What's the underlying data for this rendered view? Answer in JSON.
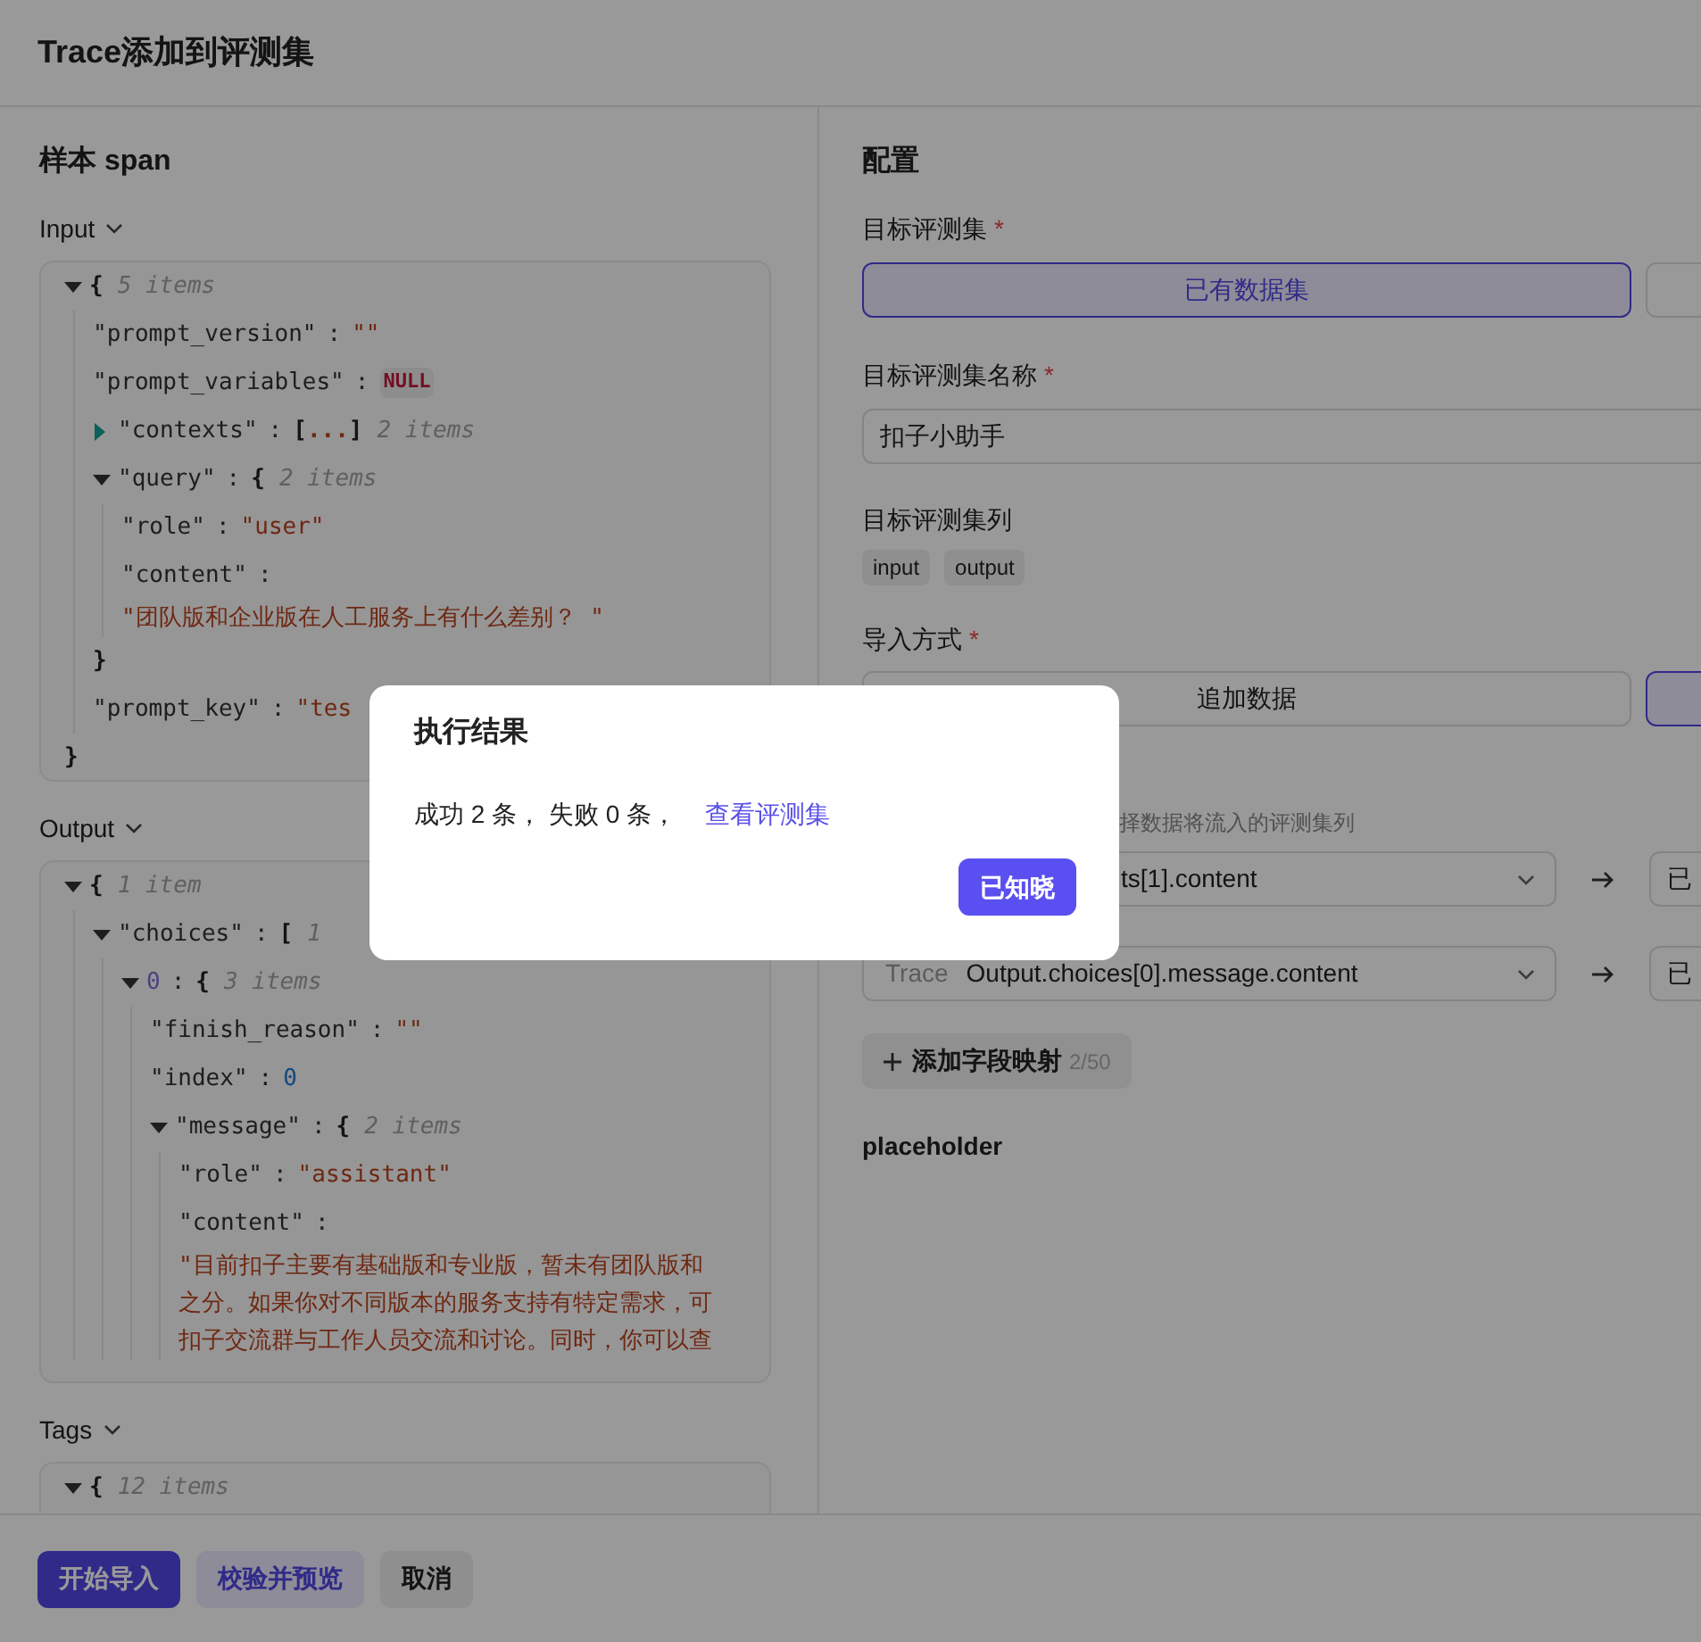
{
  "window": {
    "title": "Trace添加到评测集"
  },
  "sample": {
    "title": "样本 span",
    "separator": ":",
    "sections": [
      {
        "label": "Input",
        "tree": {
          "open": "{",
          "summary": "5 items",
          "expanded": true,
          "close": "}",
          "children": [
            {
              "key": "\"prompt_version\"",
              "value": "\"\"",
              "kind": "string"
            },
            {
              "key": "\"prompt_variables\"",
              "value": "NULL",
              "kind": "null"
            },
            {
              "key": "\"contexts\"",
              "open": "[",
              "ellipsis": "...",
              "close": "]",
              "summary": "2 items",
              "expanded": false
            },
            {
              "key": "\"query\"",
              "open": "{",
              "summary": "2 items",
              "expanded": true,
              "close": "}",
              "children": [
                {
                  "key": "\"role\"",
                  "value": "\"user\"",
                  "kind": "string"
                },
                {
                  "key": "\"content\"",
                  "value_lines": [
                    "\"团队版和企业版在人工服务上有什么差别？ \""
                  ],
                  "kind": "string"
                }
              ]
            },
            {
              "key": "\"prompt_key\"",
              "value": "\"tes",
              "kind": "string"
            }
          ]
        }
      },
      {
        "label": "Output",
        "tree": {
          "open": "{",
          "summary": "1 item",
          "expanded": true,
          "children": [
            {
              "key": "\"choices\"",
              "open": "[",
              "summary": "1",
              "expanded": true,
              "children": [
                {
                  "key": "0",
                  "kind": "index",
                  "open": "{",
                  "summary": "3 items",
                  "expanded": true,
                  "children": [
                    {
                      "key": "\"finish_reason\"",
                      "value": "\"\"",
                      "kind": "string"
                    },
                    {
                      "key": "\"index\"",
                      "value": "0",
                      "kind": "number"
                    },
                    {
                      "key": "\"message\"",
                      "open": "{",
                      "summary": "2 items",
                      "expanded": true,
                      "children": [
                        {
                          "key": "\"role\"",
                          "value": "\"assistant\"",
                          "kind": "string"
                        },
                        {
                          "key": "\"content\"",
                          "value_lines": [
                            "\"目前扣子主要有基础版和专业版，暂未有团队版和",
                            "之分。如果你对不同版本的服务支持有特定需求，可",
                            "扣子交流群与工作人员交流和讨论。同时，你可以查"
                          ],
                          "kind": "string"
                        }
                      ]
                    }
                  ]
                }
              ]
            }
          ]
        }
      },
      {
        "label": "Tags",
        "tree": {
          "open": "{",
          "summary": "12 items",
          "expanded": true
        }
      }
    ]
  },
  "config": {
    "title": "配置",
    "required_mark": "*",
    "target_dataset": {
      "label": "目标评测集",
      "required": true,
      "options": [
        {
          "label": "已有数据集",
          "selected": true
        },
        {
          "selected": false
        }
      ]
    },
    "dataset_name": {
      "label": "目标评测集名称",
      "required": true,
      "value": "扣子小助手"
    },
    "dataset_columns": {
      "label": "目标评测集列",
      "tags": [
        "input",
        "output"
      ]
    },
    "import_mode": {
      "label": "导入方式",
      "required": true,
      "options": [
        {
          "label": "追加数据",
          "selected": false
        },
        {
          "selected": true
        }
      ]
    },
    "mapping_hint": "择数据将流入的评测集列",
    "mappings": [
      {
        "source": "ts[1].content",
        "target": "已"
      },
      {
        "source_tag": "Trace",
        "source": "Output.choices[0].message.content",
        "target": "已"
      }
    ],
    "add_mapping": {
      "label": "添加字段映射",
      "count": "2/50"
    },
    "placeholder_text": "placeholder"
  },
  "footer": {
    "buttons": [
      {
        "label": "开始导入",
        "kind": "primary"
      },
      {
        "label": "校验并预览",
        "kind": "secondary"
      },
      {
        "label": "取消",
        "kind": "plain"
      }
    ]
  },
  "dialog": {
    "title": "执行结果",
    "message": "成功 2 条， 失败 0 条，",
    "link": "查看评测集",
    "button": "已知晓"
  }
}
